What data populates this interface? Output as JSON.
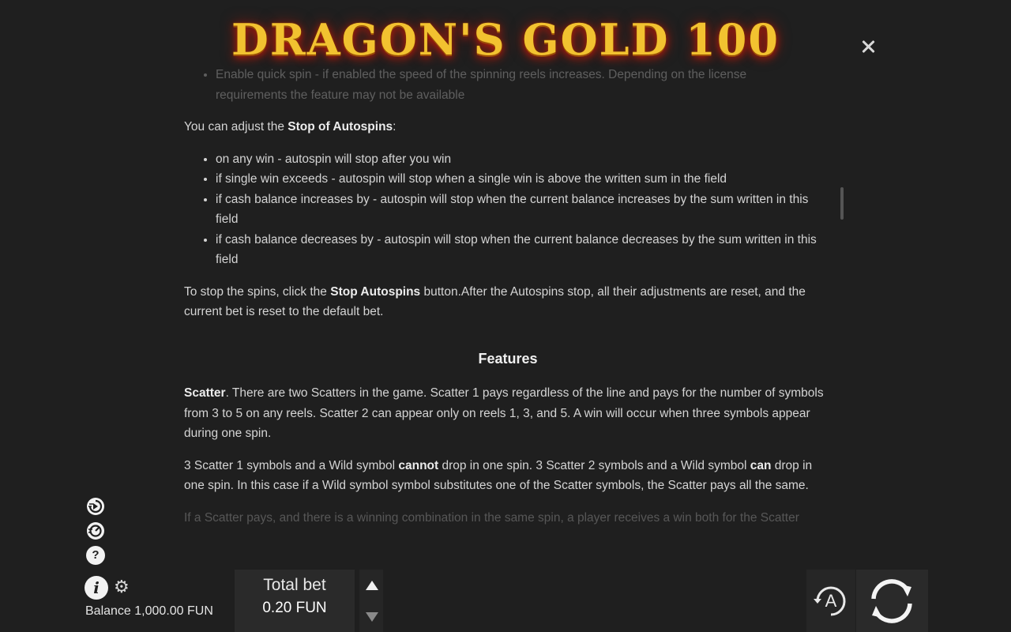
{
  "header": {
    "logo_text": "DRAGON'S GOLD 100",
    "close_label": "×"
  },
  "rules": {
    "top_faded_item_line1": "Enable quick spin - if enabled the speed of the spinning reels increases. Depending on the license",
    "top_faded_item_line2": "requirements the feature may not be available",
    "stop_intro_prefix": "You can adjust the ",
    "stop_intro_bold": "Stop of Autospins",
    "stop_intro_suffix": ":",
    "stop_items": [
      "on any win - autospin will stop after you win",
      "if single win exceeds - autospin will stop when a single win is above the written sum in the field",
      "if cash balance increases by - autospin will stop when the current balance increases by the sum written in this field",
      "if cash balance decreases by - autospin will stop when the current balance decreases by the sum written in this field"
    ],
    "stop_click_prefix": "To stop the spins, click the ",
    "stop_click_bold": "Stop Autospins",
    "stop_click_suffix": " button.After the Autospins stop, all their adjustments are reset, and the current bet is reset to the default bet.",
    "features_title": "Features",
    "scatter_bold": "Scatter",
    "scatter_text": ". There are two Scatters in the game. Scatter 1 pays regardless of the line and pays for the number of symbols from 3 to 5 on any reels. Scatter 2 can appear only on reels 1, 3, and 5. A win will occur when three symbols appear during one spin.",
    "wild_p1": "3 Scatter 1 symbols and a Wild symbol ",
    "wild_bold1": "cannot",
    "wild_p2": " drop in one spin. 3 Scatter 2 symbols and a Wild symbol ",
    "wild_bold2": "can",
    "wild_p3": " drop in one spin. In this case if a Wild symbol symbol substitutes one of the Scatter symbols, the Scatter pays all the same.",
    "bottom_faded": "If a Scatter pays, and there is a winning combination in the same spin, a player receives a win both for the Scatter"
  },
  "toolbar": {
    "balance_label": "Balance",
    "balance_value": "1,000.00 FUN",
    "total_bet_label": "Total bet",
    "total_bet_value": "0.20 FUN",
    "auto_label": "A",
    "help_label": "?",
    "info_label": "i"
  },
  "icons": {
    "left": [
      "quick-spin-icon",
      "turbo-icon",
      "help-icon",
      "info-icon",
      "gear-icon"
    ],
    "bet": [
      "arrow-up-icon",
      "arrow-down-icon"
    ],
    "right": [
      "autoplay-icon",
      "spin-icon"
    ]
  }
}
